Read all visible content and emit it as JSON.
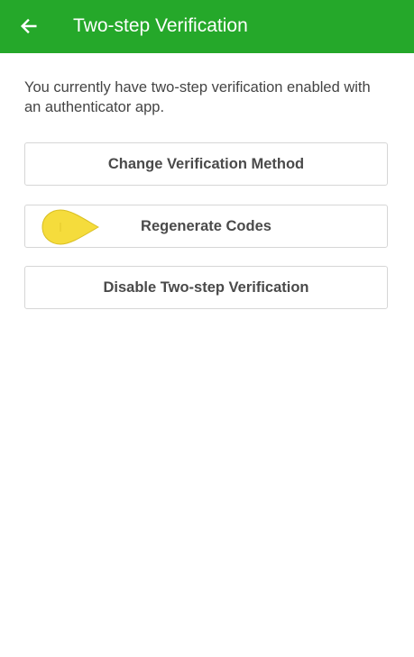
{
  "appbar": {
    "title": "Two-step Verification",
    "background_color": "#25a82a",
    "back_icon": "arrow-left-icon"
  },
  "main": {
    "description": "You currently have two-step verification enabled with an authenticator app.",
    "buttons": [
      {
        "label": "Change Verification Method"
      },
      {
        "label": "Regenerate Codes"
      },
      {
        "label": "Disable Two-step Verification"
      }
    ]
  },
  "overlay": {
    "tap_indicator_color": "#f5dc3c"
  }
}
